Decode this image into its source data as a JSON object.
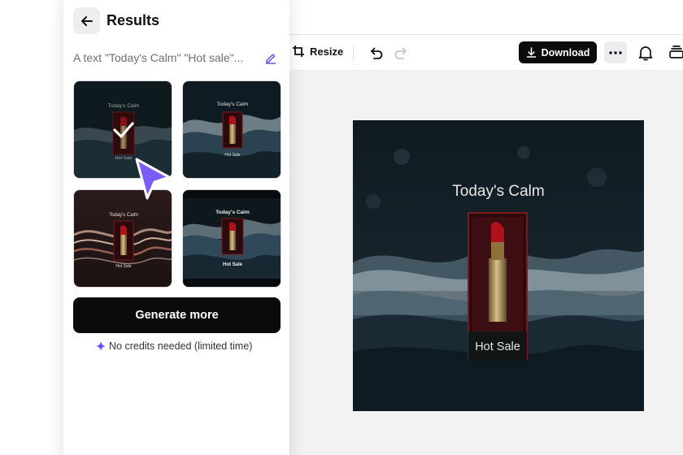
{
  "toolbar": {
    "resize_label": "Resize",
    "download_label": "Download"
  },
  "panel": {
    "title": "Results",
    "prompt": "A text \"Today's Calm\" \"Hot sale\"...",
    "generate_label": "Generate more",
    "credits_note": "No credits needed (limited time)"
  },
  "canvas": {
    "headline": "Today's Calm",
    "tagline": "Hot Sale"
  },
  "results": [
    {
      "headline": "Today's Calm",
      "tagline": "Hot Sale",
      "selected": true
    },
    {
      "headline": "Today's Calm",
      "tagline": "Hot Sale",
      "selected": false
    },
    {
      "headline": "Today's Calm",
      "tagline": "Hot Sale",
      "selected": false
    },
    {
      "headline": "Today's Calm",
      "tagline": "Hot Sale",
      "selected": false
    }
  ],
  "colors": {
    "accent": "#6b4cf6",
    "button_dark": "#0b0b0c",
    "lipstick_red": "#b0121c"
  },
  "icons": [
    "back-arrow-icon",
    "edit-pencil-icon",
    "checkmark-icon",
    "sparkle-icon",
    "resize-icon",
    "undo-icon",
    "redo-icon",
    "download-icon",
    "more-icon",
    "bell-icon",
    "layers-icon",
    "pointer-cursor-icon"
  ]
}
